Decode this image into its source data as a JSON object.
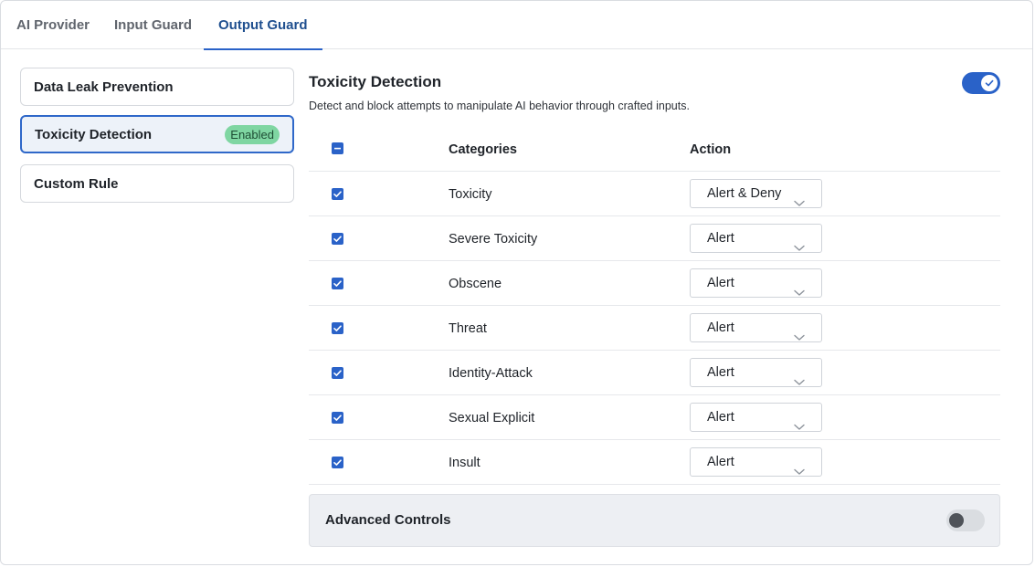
{
  "tabs": [
    {
      "label": "AI Provider"
    },
    {
      "label": "Input Guard"
    },
    {
      "label": "Output Guard"
    }
  ],
  "sidebar": {
    "items": [
      {
        "label": "Data Leak Prevention"
      },
      {
        "label": "Toxicity Detection",
        "badge": "Enabled"
      },
      {
        "label": "Custom Rule"
      }
    ]
  },
  "section": {
    "title": "Toxicity Detection",
    "description": "Detect and block attempts to manipulate AI behavior through crafted inputs.",
    "enabled": true
  },
  "table": {
    "headers": {
      "categories": "Categories",
      "action": "Action"
    },
    "rows": [
      {
        "category": "Toxicity",
        "action": "Alert & Deny",
        "checked": true
      },
      {
        "category": "Severe Toxicity",
        "action": "Alert",
        "checked": true
      },
      {
        "category": "Obscene",
        "action": "Alert",
        "checked": true
      },
      {
        "category": "Threat",
        "action": "Alert",
        "checked": true
      },
      {
        "category": "Identity-Attack",
        "action": "Alert",
        "checked": true
      },
      {
        "category": "Sexual Explicit",
        "action": "Alert",
        "checked": true
      },
      {
        "category": "Insult",
        "action": "Alert",
        "checked": true
      }
    ]
  },
  "advanced": {
    "label": "Advanced Controls",
    "enabled": false
  },
  "colors": {
    "accent": "#2a62c8",
    "active_tab_text": "#1f4f8f",
    "badge_bg": "#7fd6a2",
    "badge_text": "#1e4d34"
  }
}
